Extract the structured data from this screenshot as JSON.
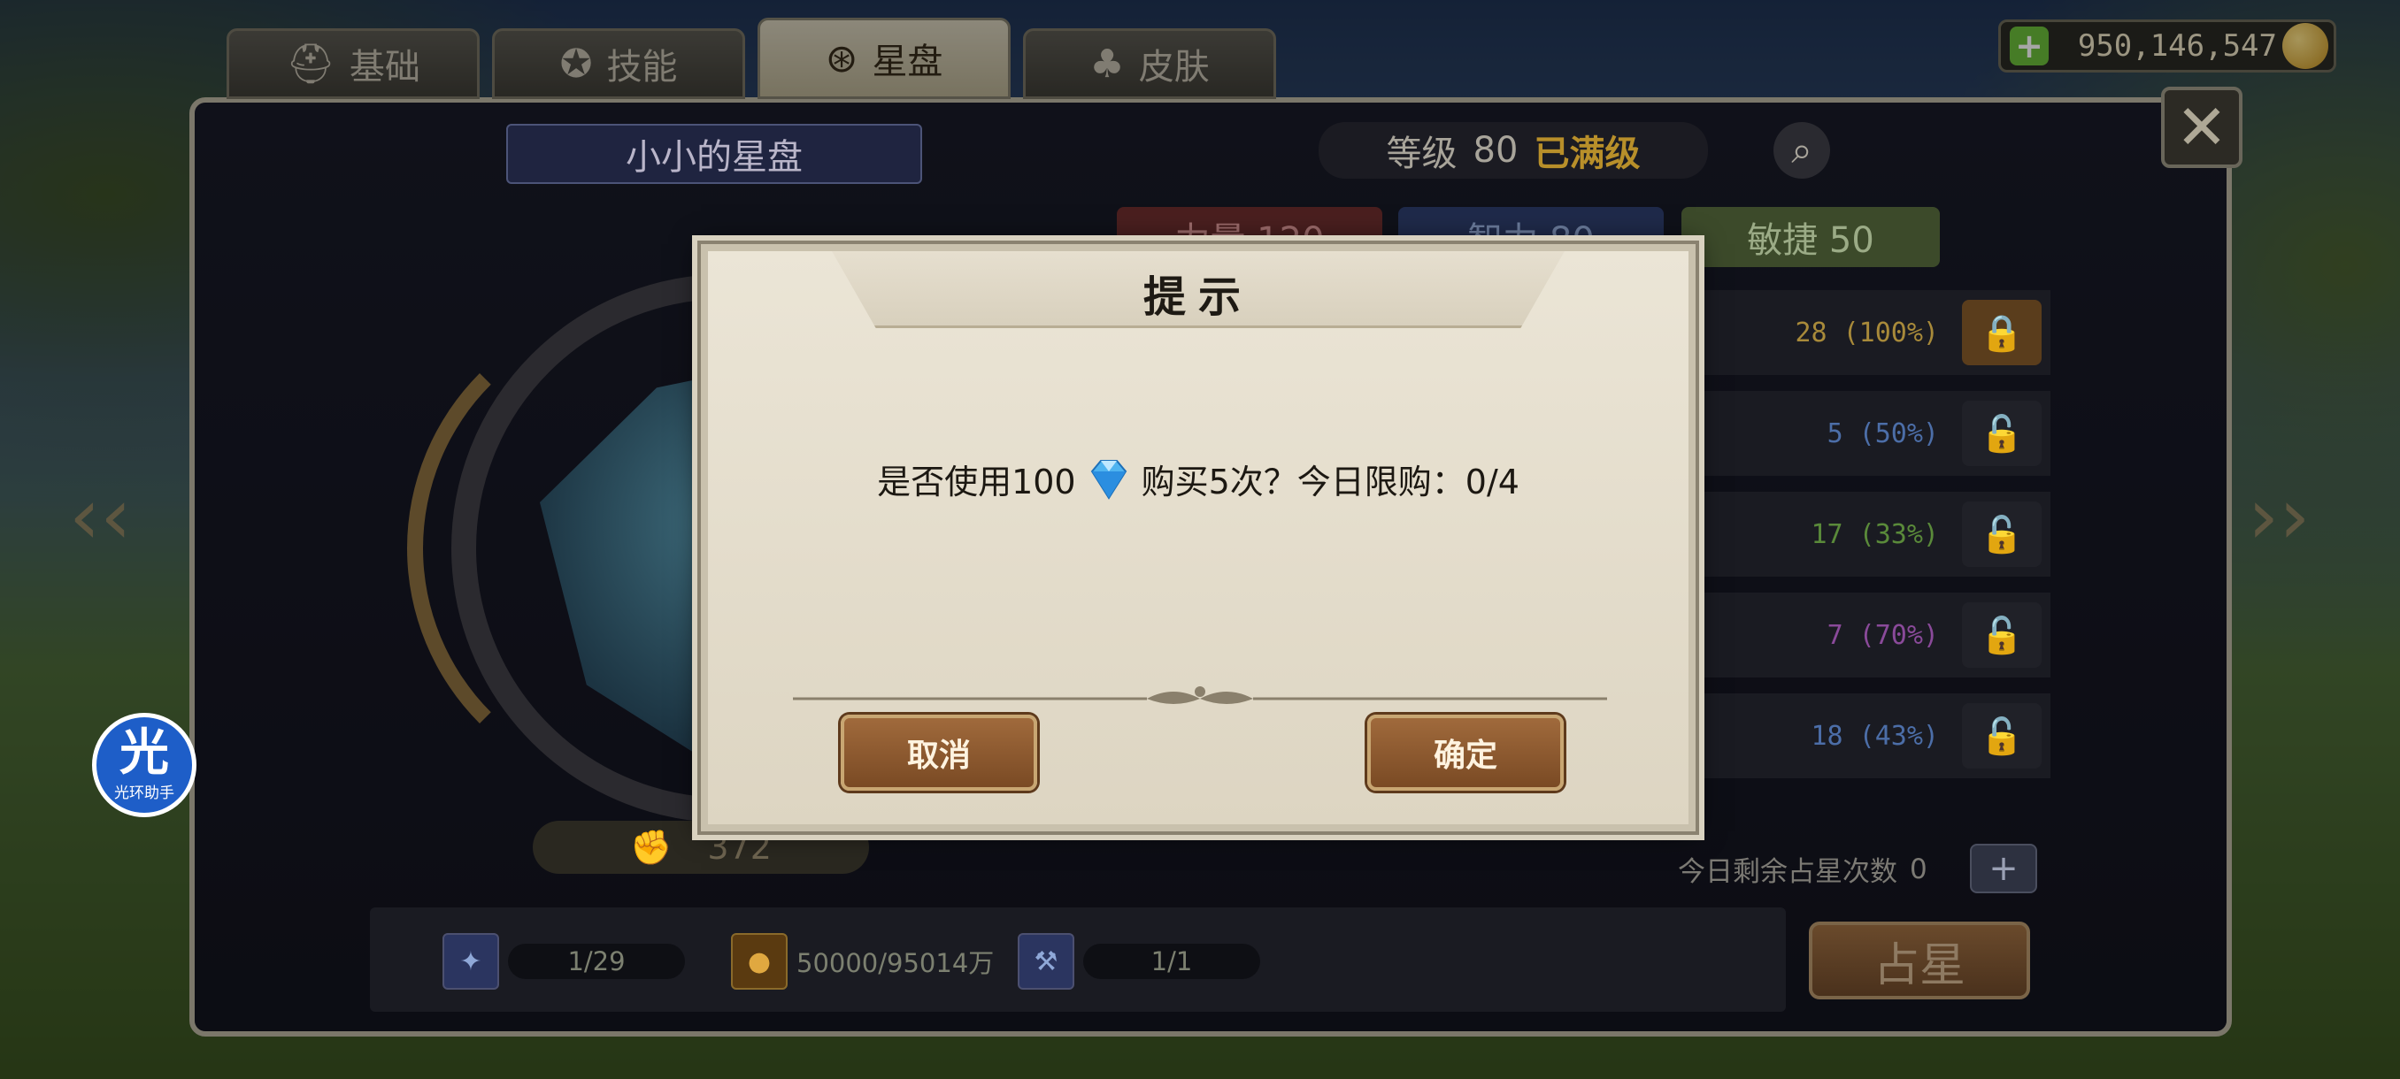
{
  "tabs": [
    {
      "label": "基础",
      "icon": "helmet-icon"
    },
    {
      "label": "技能",
      "icon": "skill-icon"
    },
    {
      "label": "星盘",
      "icon": "astrolabe-icon"
    },
    {
      "label": "皮肤",
      "icon": "skin-icon"
    }
  ],
  "active_tab": "星盘",
  "currency": {
    "amount": "950,146,547"
  },
  "board": {
    "title": "小小的星盘",
    "level_label": "等级",
    "level_value": "80",
    "level_status": "已满级"
  },
  "stats": {
    "str": "力量 120",
    "int": "智力 80",
    "agi": "敏捷 50"
  },
  "rows": [
    {
      "value": "28 (100%)",
      "color": "#a88a3a"
    },
    {
      "value": "5 (50%)",
      "color": "#4c6ea8"
    },
    {
      "value": "17 (33%)",
      "color": "#5a8a3a"
    },
    {
      "value": "7 (70%)",
      "color": "#8a4a9a"
    },
    {
      "value": "18 (43%)",
      "color": "#4c6ea8"
    }
  ],
  "remaining": {
    "label": "今日剩余占星次数",
    "count": "0"
  },
  "astro_button": "占星",
  "points": "372",
  "resources": [
    {
      "value": "1/29"
    },
    {
      "value": "50000/95014万"
    },
    {
      "value": "1/1"
    }
  ],
  "helper": {
    "glyph": "光",
    "label": "光环助手"
  },
  "dialog": {
    "title": "提示",
    "message_prefix": "是否使用100",
    "message_suffix": "购买5次？今日限购：0/4",
    "cancel": "取消",
    "confirm": "确定"
  }
}
